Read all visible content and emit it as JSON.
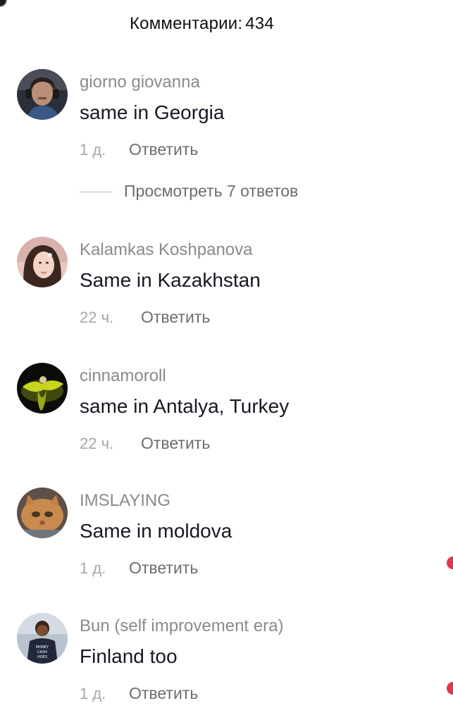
{
  "header": {
    "label": "Комментарии:",
    "count": "434"
  },
  "comments": [
    {
      "username": "giorno giovanna",
      "text": "same in Georgia",
      "time": "1 д.",
      "reply_label": "Ответить",
      "avatar_icon": "avatar-photo-man-headphones",
      "view_replies": "Просмотреть 7 ответов"
    },
    {
      "username": "Kalamkas Koshpanova",
      "text": "Same in Kazakhstan",
      "time": "22 ч.",
      "reply_label": "Ответить",
      "avatar_icon": "avatar-photo-selfie"
    },
    {
      "username": "cinnamoroll",
      "text": "same in Antalya, Turkey",
      "time": "22 ч.",
      "reply_label": "Ответить",
      "avatar_icon": "avatar-photo-dancer"
    },
    {
      "username": "IMSLAYING",
      "text": "Same in moldova",
      "time": "1 д.",
      "reply_label": "Ответить",
      "avatar_icon": "avatar-photo-cat"
    },
    {
      "username": "Bun (self improvement era)",
      "text": "Finland too",
      "time": "1 д.",
      "reply_label": "Ответить",
      "avatar_icon": "avatar-photo-child",
      "avatar_shirt_text": "MONEY CASH HOES"
    }
  ],
  "colors": {
    "username": "#8a8a8f",
    "text": "#161823",
    "meta": "#a6a6ab",
    "reply": "#6d6d72",
    "like_accent": "#fe2c55"
  }
}
